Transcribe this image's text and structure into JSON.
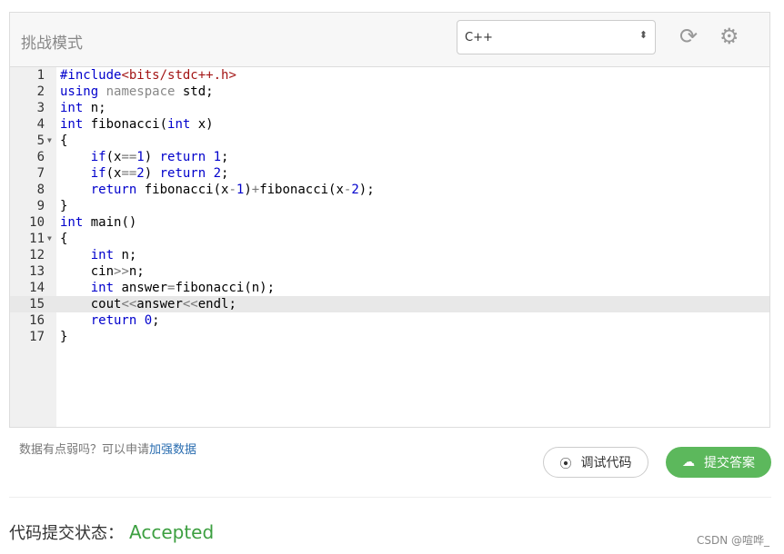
{
  "header": {
    "title": "挑战模式",
    "language": "C++",
    "refresh_icon": "refresh-icon",
    "settings_icon": "gear-icon"
  },
  "editor": {
    "active_line": 15,
    "lines": [
      [
        [
          "kw",
          "#include"
        ],
        [
          "str",
          "<bits/stdc++.h>"
        ]
      ],
      [
        [
          "kw",
          "using"
        ],
        [
          "",
          ""
        ],
        [
          "ns",
          " namespace"
        ],
        [
          "",
          " std;"
        ]
      ],
      [
        [
          "kw",
          "int"
        ],
        [
          "",
          " n;"
        ]
      ],
      [
        [
          "kw",
          "int"
        ],
        [
          "",
          " fibonacci("
        ],
        [
          "kw",
          "int"
        ],
        [
          "",
          " x)"
        ]
      ],
      [
        [
          "",
          "{"
        ]
      ],
      [
        [
          "",
          "    "
        ],
        [
          "kw",
          "if"
        ],
        [
          "",
          "(x"
        ],
        [
          "op",
          "=="
        ],
        [
          "num",
          "1"
        ],
        [
          "",
          ") "
        ],
        [
          "kw",
          "return"
        ],
        [
          "",
          " "
        ],
        [
          "num",
          "1"
        ],
        [
          "",
          ";"
        ]
      ],
      [
        [
          "",
          "    "
        ],
        [
          "kw",
          "if"
        ],
        [
          "",
          "(x"
        ],
        [
          "op",
          "=="
        ],
        [
          "num",
          "2"
        ],
        [
          "",
          ") "
        ],
        [
          "kw",
          "return"
        ],
        [
          "",
          " "
        ],
        [
          "num",
          "2"
        ],
        [
          "",
          ";"
        ]
      ],
      [
        [
          "",
          "    "
        ],
        [
          "kw",
          "return"
        ],
        [
          "",
          " fibonacci(x"
        ],
        [
          "op",
          "-"
        ],
        [
          "num",
          "1"
        ],
        [
          "",
          ")"
        ],
        [
          "op",
          "+"
        ],
        [
          "",
          "fibonacci(x"
        ],
        [
          "op",
          "-"
        ],
        [
          "num",
          "2"
        ],
        [
          "",
          ");"
        ]
      ],
      [
        [
          "",
          "}"
        ]
      ],
      [
        [
          "kw",
          "int"
        ],
        [
          "",
          " main()"
        ]
      ],
      [
        [
          "",
          "{"
        ]
      ],
      [
        [
          "",
          "    "
        ],
        [
          "kw",
          "int"
        ],
        [
          "",
          " n;"
        ]
      ],
      [
        [
          "",
          "    cin"
        ],
        [
          "op",
          ">>"
        ],
        [
          "",
          "n;"
        ]
      ],
      [
        [
          "",
          "    "
        ],
        [
          "kw",
          "int"
        ],
        [
          "",
          " answer"
        ],
        [
          "op",
          "="
        ],
        [
          "",
          "fibonacci(n);"
        ]
      ],
      [
        [
          "",
          "    cout"
        ],
        [
          "op",
          "<<"
        ],
        [
          "",
          "answer"
        ],
        [
          "op",
          "<<"
        ],
        [
          "",
          "endl;"
        ]
      ],
      [
        [
          "",
          "    "
        ],
        [
          "kw",
          "return"
        ],
        [
          "",
          " "
        ],
        [
          "num",
          "0"
        ],
        [
          "",
          ";"
        ]
      ],
      [
        [
          "",
          "}"
        ]
      ]
    ],
    "fold_lines": [
      5,
      11
    ]
  },
  "footer": {
    "hint_prefix": "数据有点弱吗？可以申请",
    "hint_link": "加强数据",
    "debug_label": "调试代码",
    "submit_label": "提交答案",
    "status_label": "代码提交状态：",
    "status_value": "Accepted",
    "status_color": "#3c9f40",
    "watermark": "CSDN @喧哗_"
  }
}
